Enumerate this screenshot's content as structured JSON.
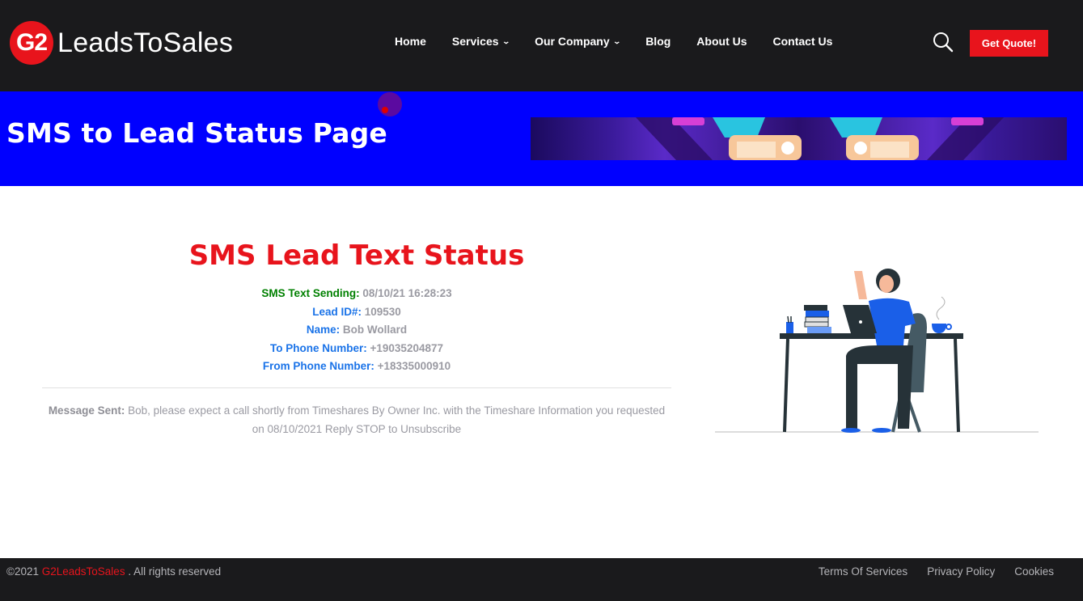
{
  "header": {
    "logo_mark": "G2",
    "logo_text": "LeadsToSales",
    "nav": [
      {
        "label": "Home",
        "has_dropdown": false
      },
      {
        "label": "Services",
        "has_dropdown": true
      },
      {
        "label": "Our Company",
        "has_dropdown": true
      },
      {
        "label": "Blog",
        "has_dropdown": false
      },
      {
        "label": "About Us",
        "has_dropdown": false
      },
      {
        "label": "Contact Us",
        "has_dropdown": false
      }
    ],
    "search_icon": "search-icon",
    "cta_label": "Get Quote!"
  },
  "banner": {
    "title": "SMS to Lead Status Page",
    "background_color": "#0000ff"
  },
  "status": {
    "title": "SMS Lead Text Status",
    "fields": [
      {
        "label": "SMS Text Sending:",
        "value": "08/10/21 16:28:23",
        "label_color": "green"
      },
      {
        "label": "Lead ID#:",
        "value": "109530",
        "label_color": "blue"
      },
      {
        "label": "Name:",
        "value": "Bob Wollard",
        "label_color": "blue"
      },
      {
        "label": "To Phone Number:",
        "value": "+19035204877",
        "label_color": "blue"
      },
      {
        "label": "From Phone Number:",
        "value": "+18335000910",
        "label_color": "blue"
      }
    ],
    "message_label": "Message Sent:",
    "message_text": "Bob, please expect a call shortly from Timeshares By Owner Inc. with the Timeshare Information you requested on 08/10/2021 Reply STOP to Unsubscribe"
  },
  "footer": {
    "copyright_prefix": "©2021",
    "brand": "G2LeadsToSales",
    "copyright_suffix": ". All rights reserved",
    "links": [
      "Terms Of Services",
      "Privacy Policy",
      "Cookies"
    ]
  },
  "colors": {
    "accent_red": "#e8141c",
    "header_bg": "#1a1a1c",
    "label_green": "#008000",
    "label_blue": "#1a73e8",
    "value_gray": "#9a9aa2"
  }
}
